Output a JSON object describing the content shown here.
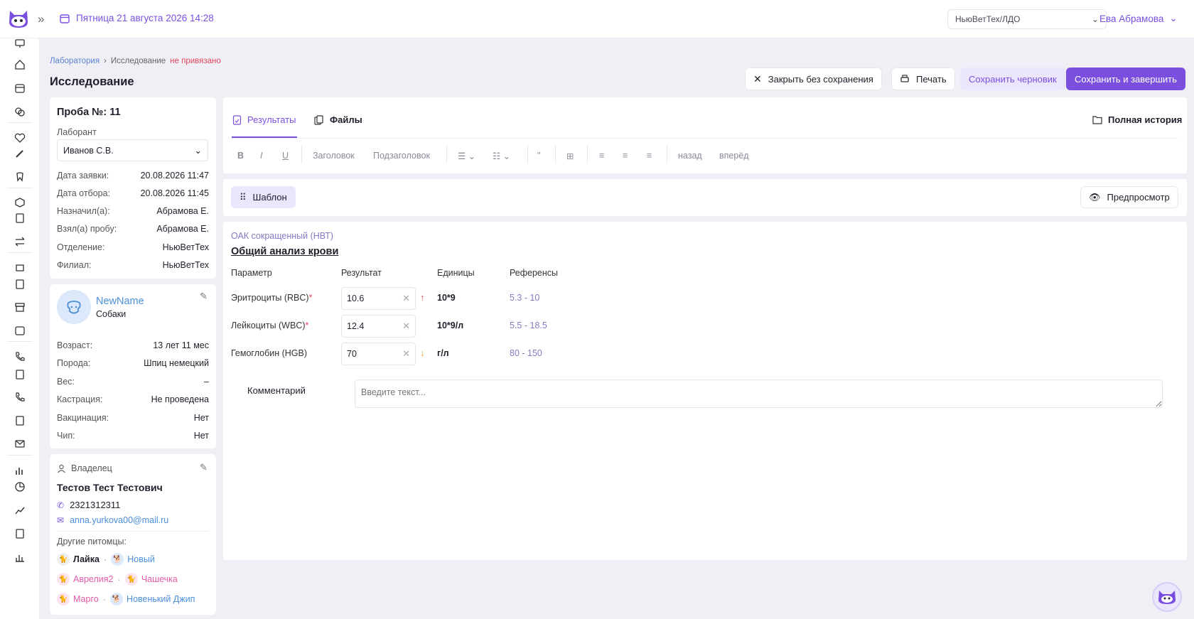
{
  "topbar": {
    "datetime": "Пятница 21 августа 2026 14:28",
    "clinic": "НьюВетТех/ЛДО",
    "user": "Ева Абрамова"
  },
  "breadcrumb": {
    "lab": "Лаборатория",
    "current": "Исследование",
    "status": "не привязано"
  },
  "page_title": "Исследование",
  "actions": {
    "close": "Закрыть без сохранения",
    "print": "Печать",
    "draft": "Сохранить черновик",
    "save": "Сохранить и завершить"
  },
  "sample": {
    "title": "Проба №: 11",
    "lab_label": "Лаборант",
    "lab_value": "Иванов С.В.",
    "rows": [
      {
        "k": "Дата заявки:",
        "v": "20.08.2026 11:47"
      },
      {
        "k": "Дата отбора:",
        "v": "20.08.2026 11:45"
      },
      {
        "k": "Назначил(а):",
        "v": "Абрамова Е."
      },
      {
        "k": "Взял(а) пробу:",
        "v": "Абрамова Е."
      },
      {
        "k": "Отделение:",
        "v": "НьюВетТех"
      },
      {
        "k": "Филиал:",
        "v": "НьюВетТех"
      }
    ]
  },
  "patient": {
    "name": "NewName",
    "species": "Собаки",
    "rows": [
      {
        "k": "Возраст:",
        "v": "13 лет 11 мес"
      },
      {
        "k": "Порода:",
        "v": "Шпиц немецкий"
      },
      {
        "k": "Вес:",
        "v": "–"
      },
      {
        "k": "Кастрация:",
        "v": "Не проведена"
      },
      {
        "k": "Вакцинация:",
        "v": "Нет"
      },
      {
        "k": "Чип:",
        "v": "Нет"
      }
    ]
  },
  "owner": {
    "label": "Владелец",
    "name": "Тестов Тест Тестович",
    "phone": "2321312311",
    "email": "anna.yurkova00@mail.ru",
    "other_label": "Другие питомцы:",
    "pets": [
      {
        "name": "Лайка",
        "color": "#1f1f2b"
      },
      {
        "name": "Новый",
        "color": "#4a8fd9"
      },
      {
        "name": "Аврелия2",
        "color": "#e35aa8"
      },
      {
        "name": "Чашечка",
        "color": "#e35aa8"
      },
      {
        "name": "Марго",
        "color": "#e35aa8"
      },
      {
        "name": "Новенький Джип",
        "color": "#4a8fd9"
      }
    ]
  },
  "tabs": {
    "results": "Результаты",
    "files": "Файлы",
    "history": "Полная история"
  },
  "toolbar": {
    "bold": "B",
    "italic": "I",
    "underline": "U",
    "heading": "Заголовок",
    "subheading": "Подзаголовок",
    "quote": "\"",
    "undo": "назад",
    "redo": "вперёд"
  },
  "template_btn": "Шаблон",
  "preview_btn": "Предпросмотр",
  "analysis": {
    "subtitle": "ОАК сокращенный (НВТ)",
    "title": "Общий анализ крови",
    "headers": [
      "Параметр",
      "Результат",
      "Единицы",
      "Референсы"
    ],
    "rows": [
      {
        "param": "Эритроциты (RBC)",
        "required": "*",
        "value": "10.6",
        "trend": "↑",
        "unit": "10*9",
        "ref": "5.3 - 10"
      },
      {
        "param": "Лейкоциты (WBC)",
        "required": "*",
        "value": "12.4",
        "trend": "",
        "unit": "10*9/л",
        "ref": "5.5 - 18.5"
      },
      {
        "param": "Гемоглобин (HGB)",
        "required": "",
        "value": "70",
        "trend": "↓",
        "unit": "г/л",
        "ref": "80 - 150"
      }
    ]
  },
  "comment": {
    "label": "Комментарий",
    "placeholder": "Введите текст..."
  },
  "colors": {
    "accent": "#7a4fe0",
    "up": "#e1485a",
    "down": "#e2a12b"
  }
}
